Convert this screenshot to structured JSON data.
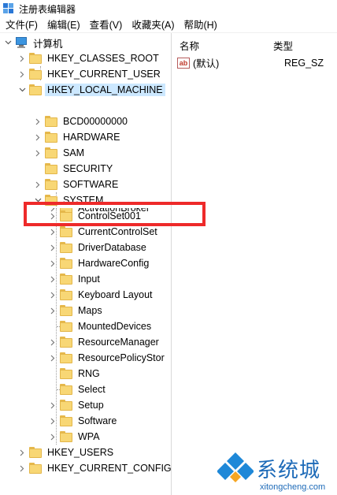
{
  "window": {
    "title": "注册表编辑器"
  },
  "menu": [
    "文件(F)",
    "编辑(E)",
    "查看(V)",
    "收藏夹(A)",
    "帮助(H)"
  ],
  "tree": {
    "root": "计算机",
    "hives": [
      "HKEY_CLASSES_ROOT",
      "HKEY_CURRENT_USER",
      "HKEY_LOCAL_MACHINE"
    ],
    "hklm_children": [
      "BCD00000000",
      "HARDWARE",
      "SAM",
      "SECURITY",
      "SOFTWARE",
      "SYSTEM"
    ],
    "system_children": [
      "ActivationBroker",
      "ControlSet001",
      "CurrentControlSet",
      "DriverDatabase",
      "HardwareConfig",
      "Input",
      "Keyboard Layout",
      "Maps",
      "MountedDevices",
      "ResourceManager",
      "ResourcePolicyStor",
      "RNG",
      "Select",
      "Setup",
      "Software",
      "WPA"
    ],
    "bottom_hives": [
      "HKEY_USERS",
      "HKEY_CURRENT_CONFIG"
    ]
  },
  "list": {
    "columns": {
      "name": "名称",
      "type": "类型"
    },
    "rows": [
      {
        "name": "(默认)",
        "type": "REG_SZ",
        "icon": "ab-string-icon"
      }
    ]
  },
  "watermark": {
    "text": "系统城",
    "url": "xitongcheng.com"
  },
  "colors": {
    "selection": "#cce8ff",
    "folder": "#f8d775",
    "highlight": "#ee2a2a",
    "watermark": "#1d6ab8"
  }
}
